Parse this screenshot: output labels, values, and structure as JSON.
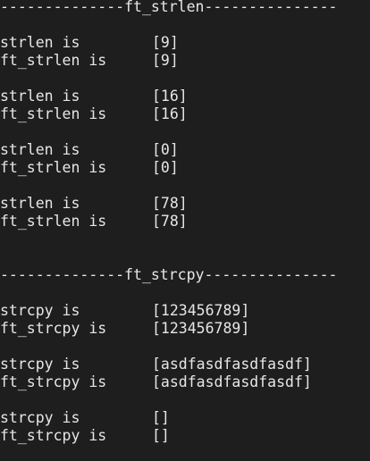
{
  "terminal": {
    "background": "#1e1e1e",
    "foreground": "#e6e6e6",
    "lines": [
      {
        "kind": "header",
        "text": "--------------ft_strlen---------------"
      },
      {
        "kind": "blank"
      },
      {
        "kind": "entry",
        "label": "strlen is",
        "value": "[9]"
      },
      {
        "kind": "entry",
        "label": "ft_strlen is",
        "value": "[9]"
      },
      {
        "kind": "blank"
      },
      {
        "kind": "entry",
        "label": "strlen is",
        "value": "[16]"
      },
      {
        "kind": "entry",
        "label": "ft_strlen is",
        "value": "[16]"
      },
      {
        "kind": "blank"
      },
      {
        "kind": "entry",
        "label": "strlen is",
        "value": "[0]"
      },
      {
        "kind": "entry",
        "label": "ft_strlen is",
        "value": "[0]"
      },
      {
        "kind": "blank"
      },
      {
        "kind": "entry",
        "label": "strlen is",
        "value": "[78]"
      },
      {
        "kind": "entry",
        "label": "ft_strlen is",
        "value": "[78]"
      },
      {
        "kind": "blank"
      },
      {
        "kind": "blank"
      },
      {
        "kind": "header",
        "text": "--------------ft_strcpy---------------"
      },
      {
        "kind": "blank"
      },
      {
        "kind": "entry",
        "label": "strcpy is",
        "value": "[123456789]"
      },
      {
        "kind": "entry",
        "label": "ft_strcpy is",
        "value": "[123456789]"
      },
      {
        "kind": "blank"
      },
      {
        "kind": "entry",
        "label": "strcpy is",
        "value": "[asdfasdfasdfasdf]"
      },
      {
        "kind": "entry",
        "label": "ft_strcpy is",
        "value": "[asdfasdfasdfasdf]"
      },
      {
        "kind": "blank"
      },
      {
        "kind": "entry",
        "label": "strcpy is",
        "value": "[]"
      },
      {
        "kind": "entry",
        "label": "ft_strcpy is",
        "value": "[]"
      }
    ]
  }
}
